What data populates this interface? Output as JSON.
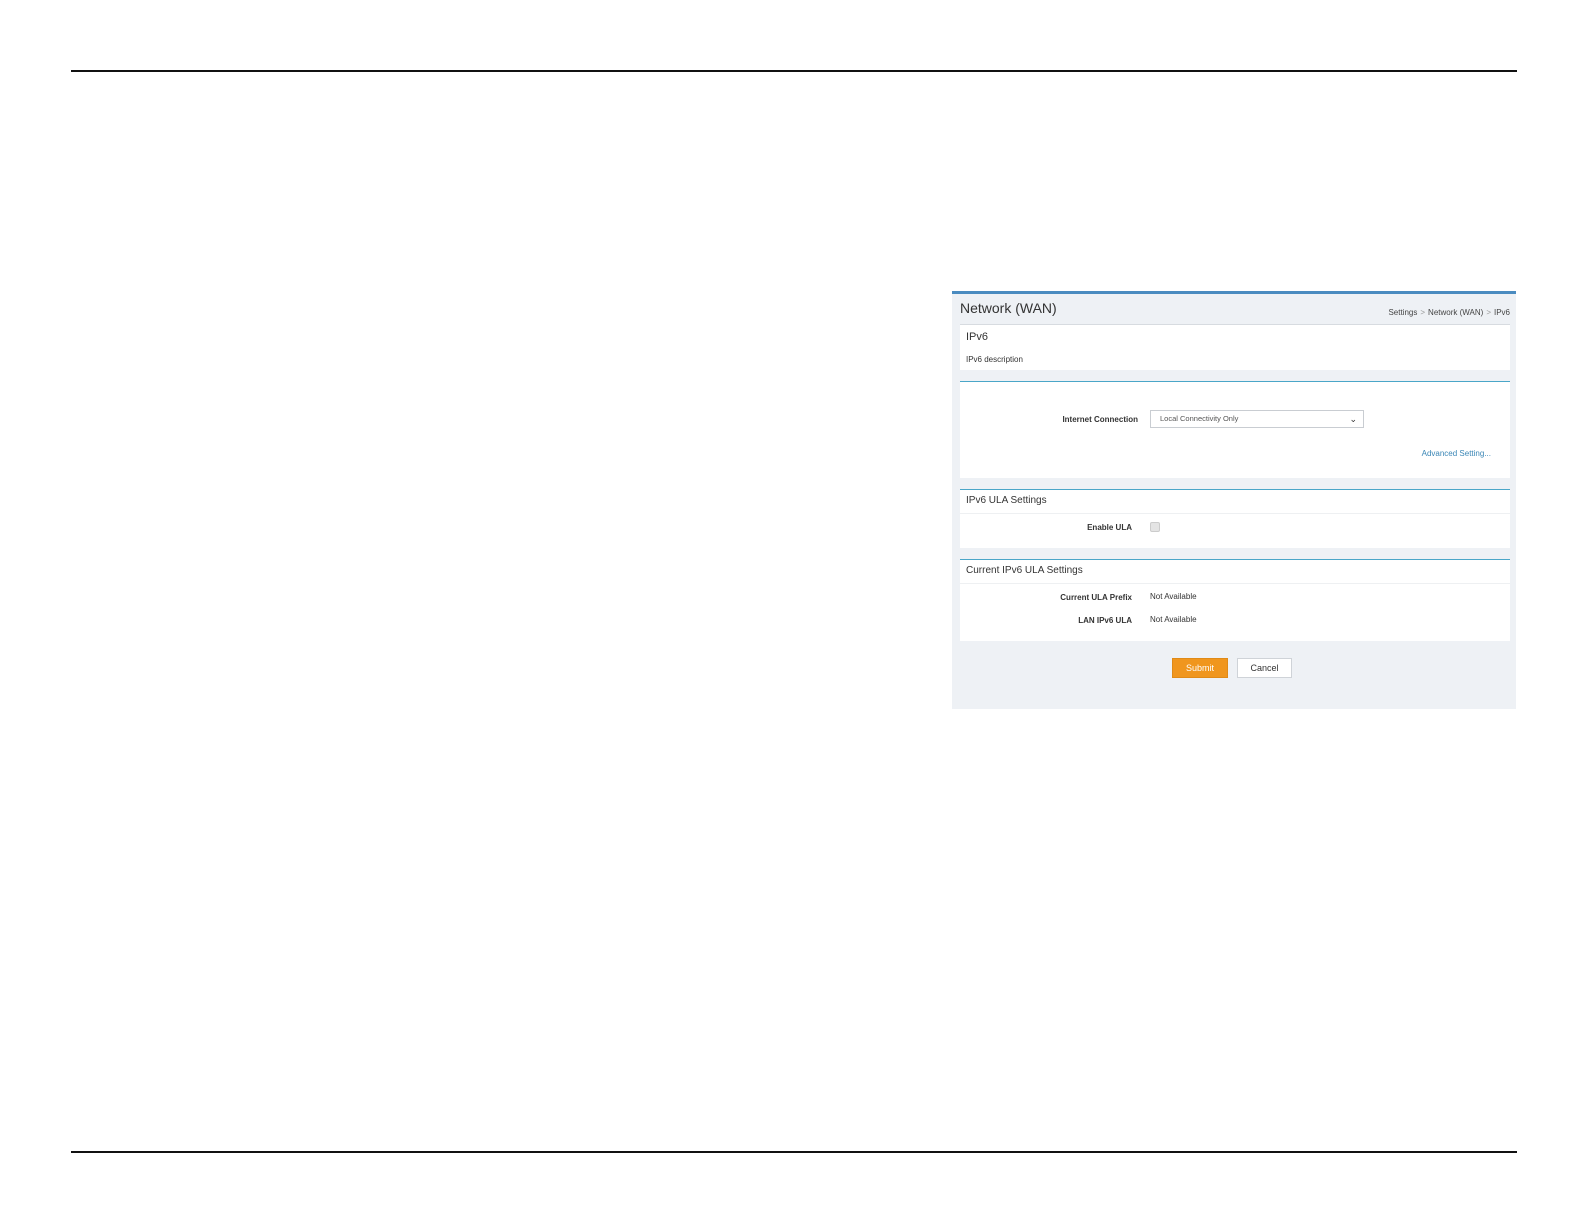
{
  "header": {
    "title": "Network (WAN)",
    "breadcrumb": [
      "Settings",
      "Network (WAN)",
      "IPv6"
    ],
    "breadcrumb_separator": ">"
  },
  "ipv6_panel": {
    "title": "IPv6",
    "description": "IPv6 description"
  },
  "connection_panel": {
    "internet_connection_label": "Internet Connection",
    "internet_connection_value": "Local Connectivity Only",
    "advanced_link": "Advanced Setting..."
  },
  "ula_panel": {
    "title": "IPv6 ULA Settings",
    "enable_label": "Enable ULA",
    "enable_checked": false
  },
  "current_ula_panel": {
    "title": "Current IPv6 ULA Settings",
    "rows": [
      {
        "label": "Current ULA Prefix",
        "value": "Not Available"
      },
      {
        "label": "LAN IPv6 ULA",
        "value": "Not Available"
      }
    ]
  },
  "buttons": {
    "submit": "Submit",
    "cancel": "Cancel"
  },
  "colors": {
    "accent": "#4a8bc0",
    "submit": "#f0961e",
    "link": "#3a86b6"
  }
}
